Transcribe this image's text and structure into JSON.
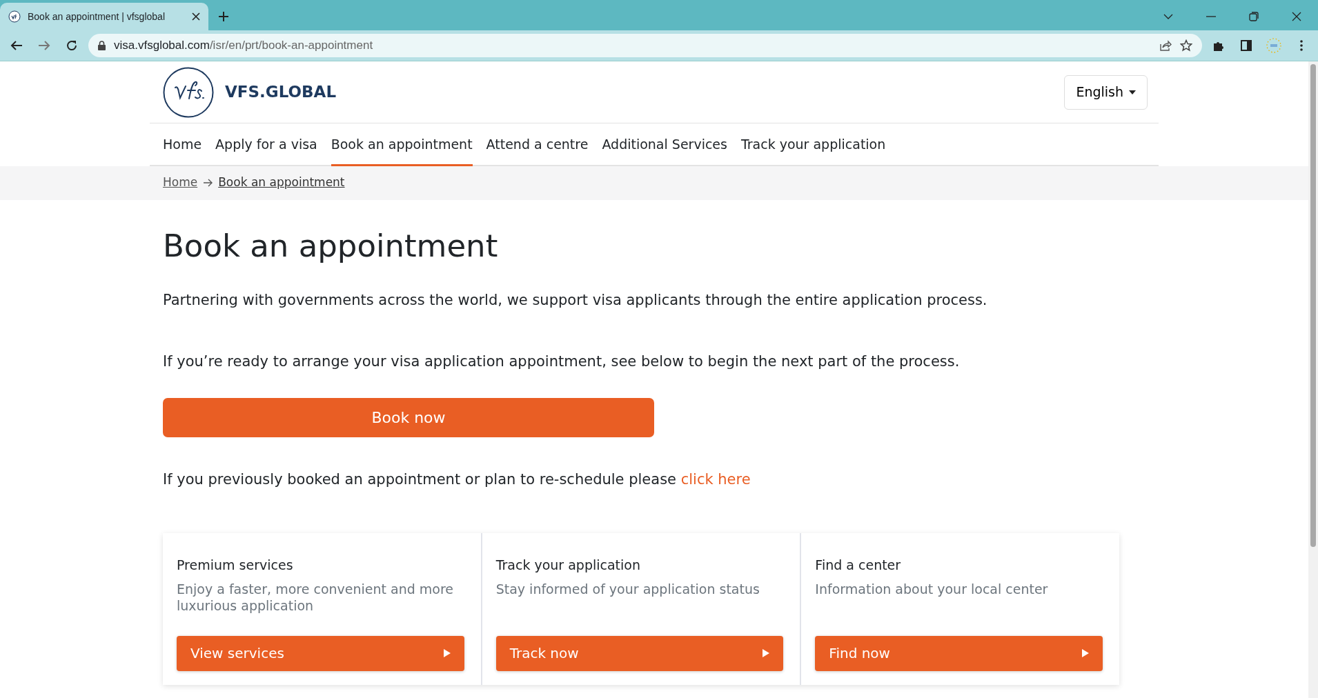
{
  "browser": {
    "tab_title": "Book an appointment | vfsglobal",
    "url_host": "visa.vfsglobal.com",
    "url_path": "/isr/en/prt/book-an-appointment"
  },
  "header": {
    "logo_text": "VFS.GLOBAL",
    "language": "English"
  },
  "nav": [
    {
      "label": "Home",
      "selected": false
    },
    {
      "label": "Apply for a visa",
      "selected": false
    },
    {
      "label": "Book an appointment",
      "selected": true
    },
    {
      "label": "Attend a centre",
      "selected": false
    },
    {
      "label": "Additional Services",
      "selected": false
    },
    {
      "label": "Track your application",
      "selected": false
    }
  ],
  "breadcrumb": [
    "Home",
    "Book an appointment"
  ],
  "title": "Book an appointment",
  "intro": "Partnering with governments across the world, we support visa applicants through the entire application process.",
  "lead": "If you’re ready to arrange your visa application appointment, see below to begin the next part of the process.",
  "book_button": "Book now",
  "reschedule": {
    "text": "If you previously booked an appointment or plan to re-schedule please",
    "link": "click here"
  },
  "cards": [
    {
      "title": "Premium services",
      "text": "Enjoy a faster, more convenient and more luxurious application",
      "button": "View services"
    },
    {
      "title": "Track your application",
      "text": "Stay informed of your application status",
      "button": "Track now"
    },
    {
      "title": "Find a center",
      "text": "Information about your local center",
      "button": "Find now"
    }
  ]
}
